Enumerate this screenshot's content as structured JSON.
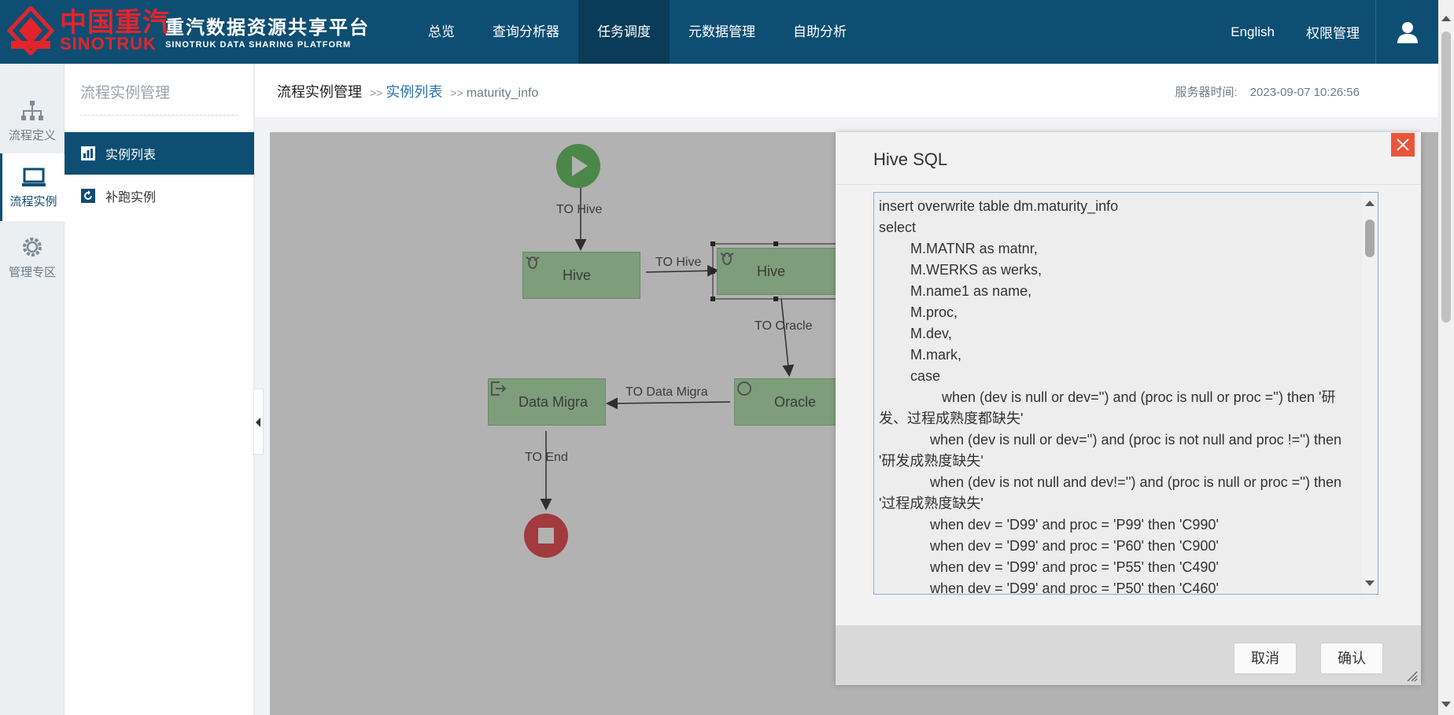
{
  "header": {
    "logo_cn": "中国重汽",
    "logo_en": "SINOTRUK",
    "brand_cn": "重汽数据资源共享平台",
    "brand_en": "SINOTRUK DATA SHARING PLATFORM",
    "nav": [
      "总览",
      "查询分析器",
      "任务调度",
      "元数据管理",
      "自助分析"
    ],
    "active_nav": "任务调度",
    "lang": "English",
    "perm": "权限管理",
    "colors": {
      "bar": "#0e4e73",
      "logo_red": "#e3242b"
    }
  },
  "rail": {
    "items": [
      {
        "label": "流程定义",
        "icon": "flowchart-icon"
      },
      {
        "label": "流程实例",
        "icon": "monitor-icon"
      },
      {
        "label": "管理专区",
        "icon": "gear-icon"
      }
    ]
  },
  "submenu": {
    "title": "流程实例管理",
    "items": [
      {
        "label": "实例列表",
        "icon": "bar-chart-icon"
      },
      {
        "label": "补跑实例",
        "icon": "refresh-icon"
      }
    ]
  },
  "breadcrumb": {
    "root": "流程实例管理",
    "sep": ">>",
    "link": "实例列表",
    "leaf": "maturity_info"
  },
  "server_time": {
    "label": "服务器时间:",
    "value": "2023-09-07 10:26:56"
  },
  "flow": {
    "nodes": [
      "Hive",
      "Hive",
      "Oracle",
      "Data Migra"
    ],
    "edges": [
      "TO Hive",
      "TO Hive",
      "TO Oracle",
      "TO Data Migra",
      "TO End"
    ]
  },
  "dialog": {
    "title": "Hive SQL",
    "sql": "insert overwrite table dm.maturity_info\nselect\n        M.MATNR as matnr,\n        M.WERKS as werks,\n        M.name1 as name,\n        M.proc,\n        M.dev,\n        M.mark,\n        case\n                when (dev is null or dev='') and (proc is null or proc ='') then '研发、过程成熟度都缺失'\n             when (dev is null or dev='') and (proc is not null and proc !='') then '研发成熟度缺失'\n             when (dev is not null and dev!='') and (proc is null or proc ='') then '过程成熟度缺失'\n             when dev = 'D99' and proc = 'P99' then 'C990'\n             when dev = 'D99' and proc = 'P60' then 'C900'\n             when dev = 'D99' and proc = 'P55' then 'C490'\n             when dev = 'D99' and proc = 'P50' then 'C460'",
    "cancel": "取消",
    "confirm": "确认"
  }
}
